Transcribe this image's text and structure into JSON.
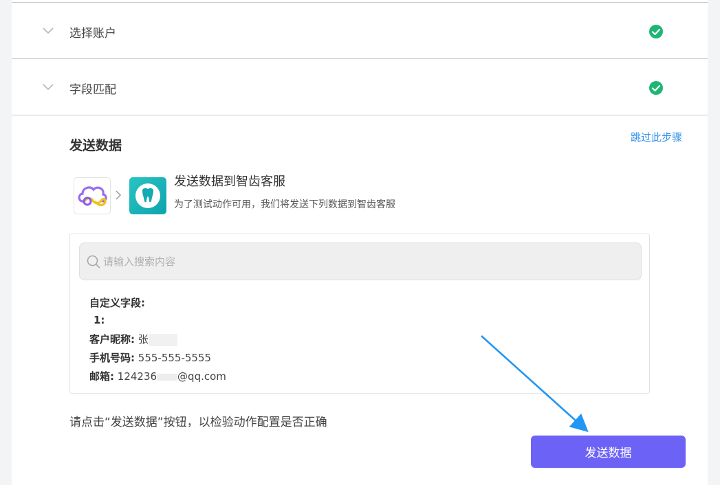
{
  "steps": [
    {
      "label": "选择账户"
    },
    {
      "label": "字段匹配"
    }
  ],
  "section": {
    "title": "发送数据",
    "skip_label": "跳过此步骤"
  },
  "send_info": {
    "title": "发送数据到智齿客服",
    "description": "为了测试动作可用，我们将发送下列数据到智齿客服"
  },
  "search": {
    "placeholder": "请输入搜索内容"
  },
  "fields": {
    "custom_label": "自定义字段:",
    "item_index": "1:",
    "nickname_label": "客户昵称:",
    "nickname_value": "张",
    "phone_label": "手机号码:",
    "phone_value": "555-555-5555",
    "email_label": "邮箱:",
    "email_prefix": "124236",
    "email_suffix": "@qq.com"
  },
  "hint": "请点击“发送数据”按钮，以检验动作配置是否正确",
  "send_button": "发送数据",
  "colors": {
    "success": "#1fb673",
    "link": "#2e8ee8",
    "primary_button": "#6c63f6",
    "annotation_arrow": "#2196f3"
  }
}
